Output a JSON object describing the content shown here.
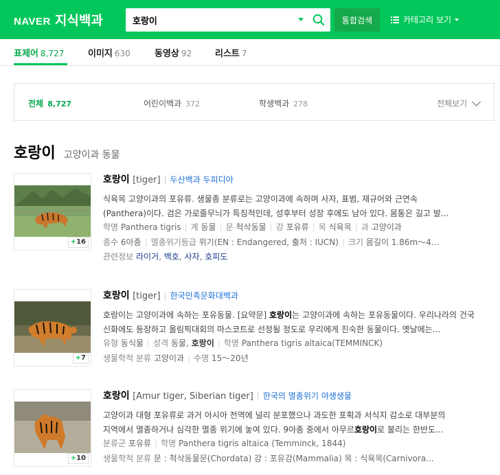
{
  "header": {
    "logo_brand": "NAVER",
    "logo_service": "지식백과",
    "search_value": "호랑이",
    "search_button": "통합검색",
    "category_button": "카테고리 보기",
    "brand_color": "#03c75a"
  },
  "tabs": [
    {
      "label": "표제어",
      "count": "8,727",
      "active": true
    },
    {
      "label": "이미지",
      "count": "630",
      "active": false
    },
    {
      "label": "동영상",
      "count": "92",
      "active": false
    },
    {
      "label": "리스트",
      "count": "7",
      "active": false
    }
  ],
  "filters": [
    {
      "label": "전체",
      "count": "8,727",
      "active": true
    },
    {
      "label": "어린이백과",
      "count": "372",
      "active": false
    },
    {
      "label": "학생백과",
      "count": "278",
      "active": false
    }
  ],
  "view_all": "전체보기",
  "section": {
    "title": "호랑이",
    "subtitle": "고양이과 동물"
  },
  "results": [
    {
      "title": "호랑이",
      "eng": "[tiger]",
      "source": "두산백과 두피디아",
      "desc1": "식육목 고양이과의 포유류. 생물종 분류로는 고양이과에 속하며 사자, 표범, 재규어와 근연속",
      "desc2": "(Panthera)이다. 검은 가로줄무늬가 특징적인데, 성후부터 성장 후에도 남아 있다. 몸통은 길고 발...",
      "meta1": [
        "학명",
        "Panthera tigris",
        "계",
        "동물",
        "문",
        "척삭동물",
        "강",
        "포유류",
        "목",
        "식육목",
        "과",
        "고양이과"
      ],
      "meta2": [
        "종수",
        "6아종",
        "멸종위기등급",
        "위기(EN : Endangered, 출처 : IUCN)",
        "크기",
        "몸길이 1.86m～4..."
      ],
      "related_label": "관련정보",
      "related": [
        "라이거",
        "백호",
        "사자",
        "호피도"
      ],
      "badge": "16"
    },
    {
      "title": "호랑이",
      "eng": "[tiger]",
      "source": "한국민족문화대백과",
      "desc1_a": "호랑이는 고양이과에 속하는 포유동물. [요약문] ",
      "desc1_b": "호랑이",
      "desc1_c": "는 고양이과에 속하는 포유동물이다. 우리나라의 건국",
      "desc2": "신화에도 등장하고 올림픽대회의 마스코트로 선정될 정도로 우리에게 친숙한 동물이다. 옛날에는...",
      "meta1_k1": "유형",
      "meta1_v1": "동식물",
      "meta1_k2": "성격",
      "meta1_v2a": "동물, ",
      "meta1_v2b": "호랑이",
      "meta1_k3": "학명",
      "meta1_v3": "Panthera tigris altaica(TEMMINCK)",
      "meta2_k1": "생물학적 분류",
      "meta2_v1": "고양이과",
      "meta2_k2": "수명",
      "meta2_v2": "15～20년",
      "badge": "7"
    },
    {
      "title": "호랑이",
      "eng": "[Amur tiger, Siberian tiger]",
      "source": "한국의 멸종위기 야생생물",
      "desc1": "고양이과 대형 포유류로 과거 아시아 전역에 널리 분포했으나 과도한 포획과 서식지 감소로 대부분의",
      "desc2_a": "지역에서 멸종하거나 심각한 멸종 위기에 놓여 있다. 9아종 중에서 아무르",
      "desc2_b": "호랑이",
      "desc2_c": "로 불리는 한반도...",
      "meta1_k1": "분류군",
      "meta1_v1": "포유류",
      "meta1_k2": "학명",
      "meta1_v2": "Panthera tigris altaica (Temminck, 1844)",
      "meta2_k1": "생물학적 분류",
      "meta2_v1": "문 : 척삭동물문(Chordata) 강 : 포유강(Mammalia) 목 : 식육목(Carnivora...",
      "badge": "10"
    }
  ]
}
